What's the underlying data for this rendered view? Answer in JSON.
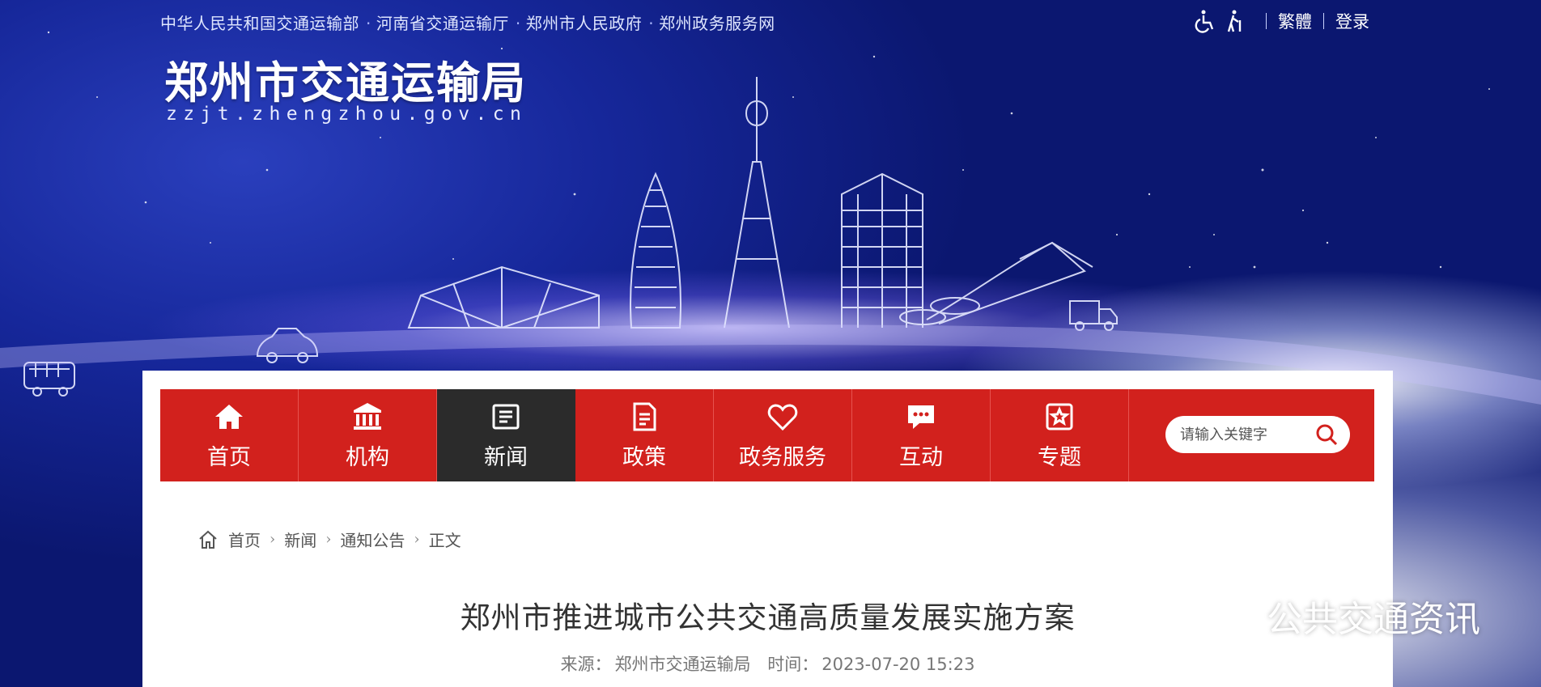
{
  "header": {
    "top_links": [
      "中华人民共和国交通运输部",
      "河南省交通运输厅",
      "郑州市人民政府",
      "郑州政务服务网"
    ],
    "separator": "·",
    "accessibility_icons": [
      "wheelchair-icon",
      "elderly-icon"
    ],
    "traditional_label": "繁體",
    "login_label": "登录",
    "site_title": "郑州市交通运输局",
    "site_domain": "zzjt.zhengzhou.gov.cn"
  },
  "nav": {
    "items": [
      {
        "label": "首页",
        "icon": "home-icon"
      },
      {
        "label": "机构",
        "icon": "institution-icon"
      },
      {
        "label": "新闻",
        "icon": "news-icon",
        "active": true
      },
      {
        "label": "政策",
        "icon": "policy-icon"
      },
      {
        "label": "政务服务",
        "icon": "heart-icon"
      },
      {
        "label": "互动",
        "icon": "chat-icon"
      },
      {
        "label": "专题",
        "icon": "star-icon"
      }
    ],
    "search_placeholder": "请输入关键字",
    "accent_color": "#d2211d",
    "active_color": "#2b2b2b"
  },
  "breadcrumb": [
    "首页",
    "新闻",
    "通知公告",
    "正文"
  ],
  "article": {
    "title": "郑州市推进城市公共交通高质量发展实施方案",
    "source_label": "来源：",
    "source": "郑州市交通运输局",
    "time_label": "时间：",
    "time": "2023-07-20 15:23"
  },
  "watermark": "公共交通资讯"
}
